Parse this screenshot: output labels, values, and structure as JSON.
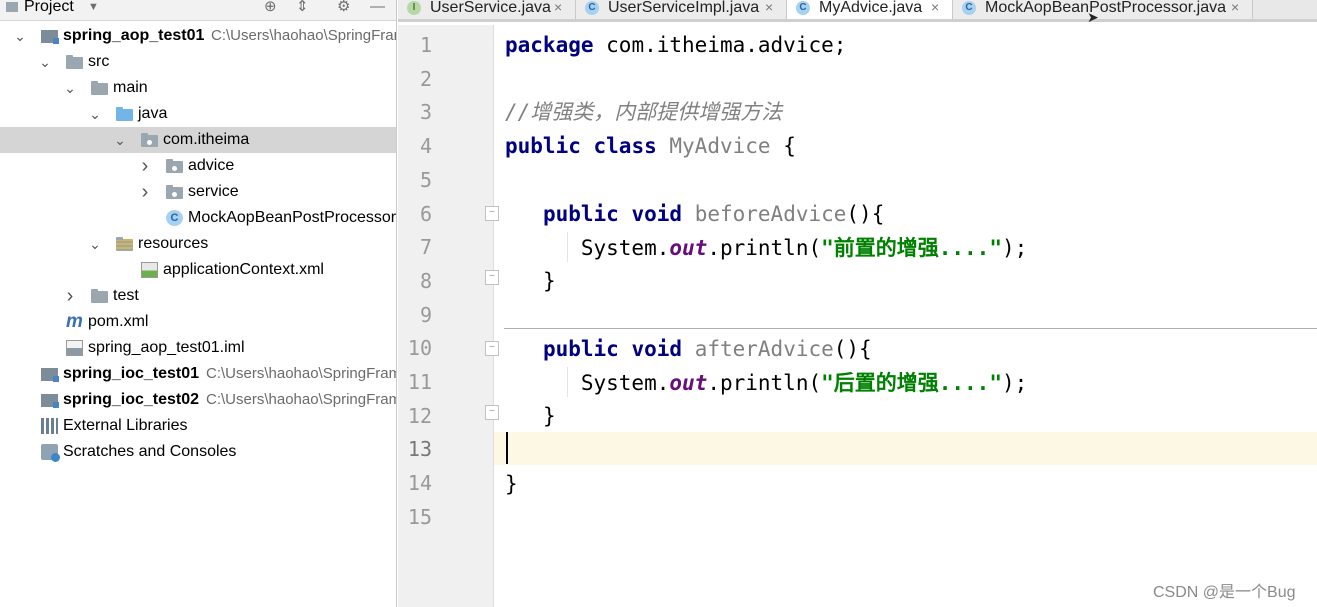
{
  "project_panel": {
    "title": "Project",
    "header_icons": {
      "dropdown": "chevron-down-icon",
      "locate": "target-icon",
      "collapse": "collapse-icon",
      "settings": "gear-icon",
      "hide": "minimize-icon"
    },
    "tree": [
      {
        "label": "spring_aop_test01",
        "path": "C:\\Users\\haohao\\SpringFrame",
        "icon": "module-icon",
        "bold": true,
        "arrow": "expanded",
        "indent": 0
      },
      {
        "label": "src",
        "icon": "folder-icon",
        "arrow": "expanded",
        "indent": 1
      },
      {
        "label": "main",
        "icon": "folder-icon",
        "arrow": "expanded",
        "indent": 2
      },
      {
        "label": "java",
        "icon": "source-folder-icon",
        "arrow": "expanded",
        "indent": 3
      },
      {
        "label": "com.itheima",
        "icon": "package-icon",
        "arrow": "expanded",
        "indent": 4,
        "selected": true
      },
      {
        "label": "advice",
        "icon": "package-icon",
        "arrow": "collapsed",
        "indent": 5
      },
      {
        "label": "service",
        "icon": "package-icon",
        "arrow": "collapsed",
        "indent": 5
      },
      {
        "label": "MockAopBeanPostProcessor",
        "icon": "class-icon",
        "arrow": "none",
        "indent": 5
      },
      {
        "label": "resources",
        "icon": "resources-folder-icon",
        "arrow": "expanded",
        "indent": 3
      },
      {
        "label": "applicationContext.xml",
        "icon": "spring-xml-icon",
        "arrow": "none",
        "indent": 4
      },
      {
        "label": "test",
        "icon": "folder-icon",
        "arrow": "collapsed",
        "indent": 2
      },
      {
        "label": "pom.xml",
        "icon": "maven-icon",
        "arrow": "none",
        "indent": 1
      },
      {
        "label": "spring_aop_test01.iml",
        "icon": "iml-file-icon",
        "arrow": "none",
        "indent": 1
      },
      {
        "label": "spring_ioc_test01",
        "path": "C:\\Users\\haohao\\SpringFramev",
        "icon": "module-icon",
        "bold": true,
        "arrow": "none",
        "indent": 0
      },
      {
        "label": "spring_ioc_test02",
        "path": "C:\\Users\\haohao\\SpringFramev",
        "icon": "module-icon",
        "bold": true,
        "arrow": "none",
        "indent": 0
      },
      {
        "label": "External Libraries",
        "icon": "libraries-icon",
        "arrow": "none",
        "indent": 0
      },
      {
        "label": "Scratches and Consoles",
        "icon": "scratches-icon",
        "arrow": "none",
        "indent": 0
      }
    ]
  },
  "tabs": [
    {
      "label": "UserService.java",
      "icon": "interface-icon",
      "icon_letter": "I",
      "active": false
    },
    {
      "label": "UserServiceImpl.java",
      "icon": "class-icon",
      "icon_letter": "C",
      "active": false
    },
    {
      "label": "MyAdvice.java",
      "icon": "class-icon",
      "icon_letter": "C",
      "active": true
    },
    {
      "label": "MockAopBeanPostProcessor.java",
      "icon": "class-icon",
      "icon_letter": "C",
      "active": false
    }
  ],
  "tab_close_glyph": "×",
  "editor": {
    "line_numbers": [
      "1",
      "2",
      "3",
      "4",
      "5",
      "6",
      "7",
      "8",
      "9",
      "10",
      "11",
      "12",
      "13",
      "14",
      "15"
    ],
    "current_line": "13",
    "code": {
      "l1_kw": "package",
      "l1_rest": " com.itheima.advice;",
      "l3_comment": "//增强类，内部提供增强方法",
      "l4_kw1": "public",
      "l4_kw2": "class",
      "l4_name": "MyAdvice",
      "l4_brace": " {",
      "l6_kw1": "public",
      "l6_kw2": "void",
      "l6_name": "beforeAdvice",
      "l6_rest": "(){",
      "l7_obj": "System.",
      "l7_field": "out",
      "l7_call": ".println(",
      "l7_str": "\"前置的增强....\"",
      "l7_end": ");",
      "l8_brace": "}",
      "l10_kw1": "public",
      "l10_kw2": "void",
      "l10_name": "afterAdvice",
      "l10_rest": "(){",
      "l11_obj": "System.",
      "l11_field": "out",
      "l11_call": ".println(",
      "l11_str": "\"后置的增强....\"",
      "l11_end": ");",
      "l12_brace": "}",
      "l14_brace": "}"
    }
  },
  "watermark": "CSDN @是一个Bug"
}
